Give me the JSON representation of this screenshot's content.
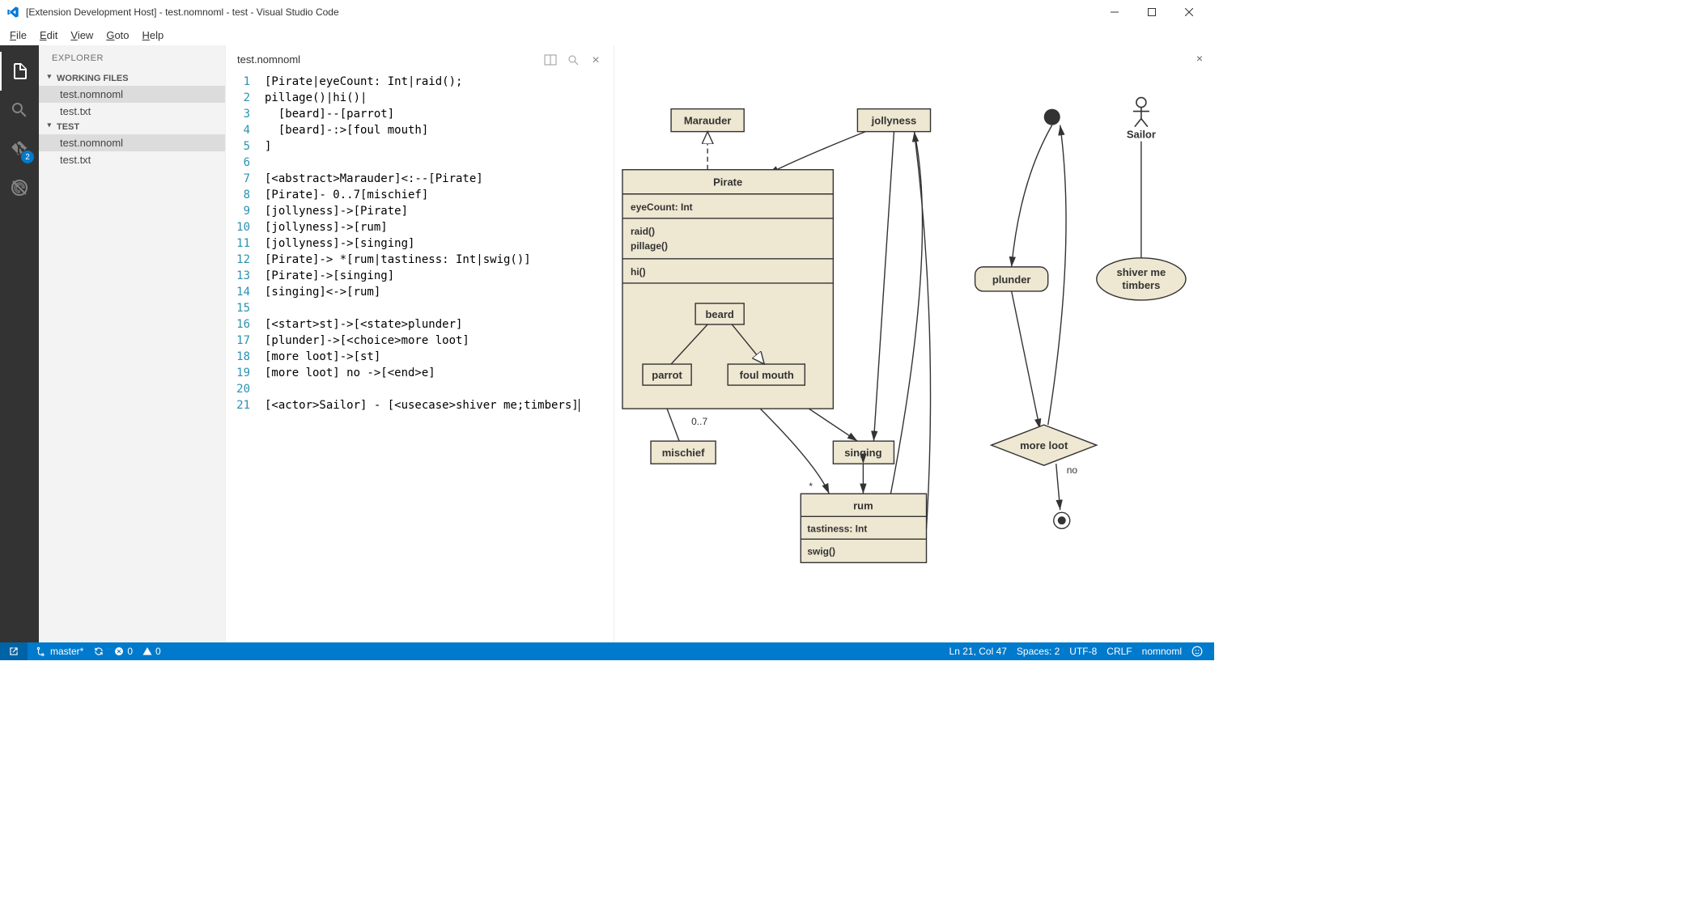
{
  "window": {
    "title": "[Extension Development Host] - test.nomnoml - test - Visual Studio Code"
  },
  "menu": {
    "file": "File",
    "edit": "Edit",
    "view": "View",
    "goto": "Goto",
    "help": "Help"
  },
  "activity": {
    "git_badge": "2"
  },
  "sidebar": {
    "title": "EXPLORER",
    "sections": {
      "working": "WORKING FILES",
      "project": "TEST"
    },
    "working_files": [
      "test.nomnoml",
      "test.txt"
    ],
    "project_files": [
      "test.nomnoml",
      "test.txt"
    ]
  },
  "editor": {
    "tab": "test.nomnoml",
    "lines": [
      "[Pirate|eyeCount: Int|raid();",
      "pillage()|hi()|",
      "  [beard]--[parrot]",
      "  [beard]-:>[foul mouth]",
      "]",
      "",
      "[<abstract>Marauder]<:--[Pirate]",
      "[Pirate]- 0..7[mischief]",
      "[jollyness]->[Pirate]",
      "[jollyness]->[rum]",
      "[jollyness]->[singing]",
      "[Pirate]-> *[rum|tastiness: Int|swig()]",
      "[Pirate]->[singing]",
      "[singing]<->[rum]",
      "",
      "[<start>st]->[<state>plunder]",
      "[plunder]->[<choice>more loot]",
      "[more loot]->[st]",
      "[more loot] no ->[<end>e]",
      "",
      "[<actor>Sailor] - [<usecase>shiver me;timbers]"
    ]
  },
  "diagram": {
    "nodes": {
      "marauder": "Marauder",
      "jollyness": "jollyness",
      "pirate": "Pirate",
      "pirate_attr": "eyeCount: Int",
      "pirate_op1": "raid()",
      "pirate_op2": "pillage()",
      "pirate_op3": "hi()",
      "beard": "beard",
      "parrot": "parrot",
      "foulmouth": "foul mouth",
      "mischief": "mischief",
      "mischief_mult": "0..7",
      "singing": "singing",
      "rum": "rum",
      "rum_attr": "tastiness: Int",
      "rum_op": "swig()",
      "rum_mult": "*",
      "plunder": "plunder",
      "moreloot": "more loot",
      "moreloot_no": "no",
      "sailor": "Sailor",
      "shiver1": "shiver me",
      "shiver2": "timbers"
    }
  },
  "status": {
    "branch": "master*",
    "errors": "0",
    "warnings": "0",
    "lncol": "Ln 21, Col 47",
    "spaces": "Spaces: 2",
    "encoding": "UTF-8",
    "eol": "CRLF",
    "lang": "nomnoml"
  }
}
